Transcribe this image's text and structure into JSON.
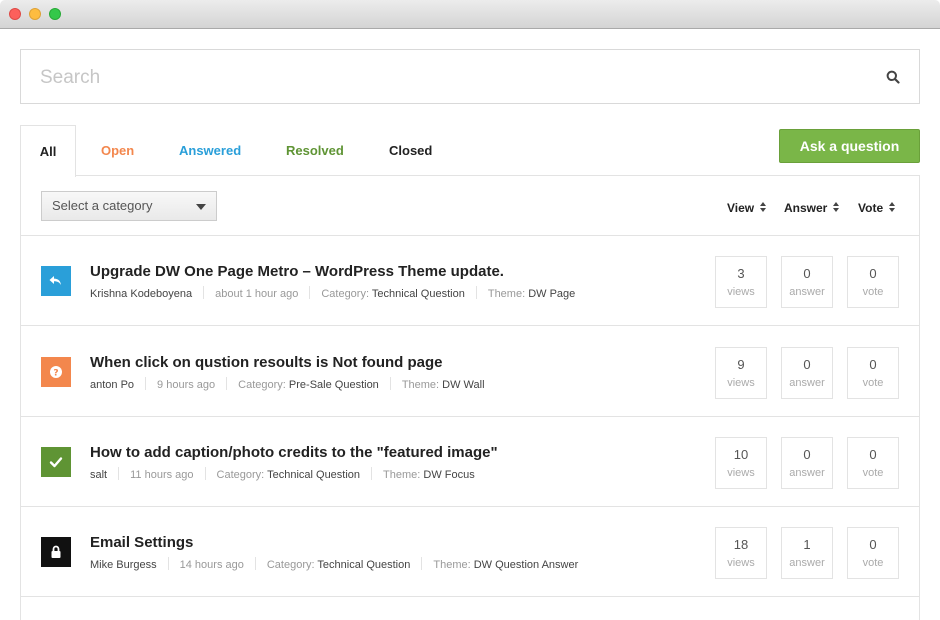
{
  "window": {
    "controls": [
      "close",
      "minimize",
      "zoom"
    ]
  },
  "search": {
    "placeholder": "Search",
    "icon": "search-icon"
  },
  "tabs": [
    {
      "label": "All",
      "color": "#222222",
      "active": true
    },
    {
      "label": "Open",
      "color": "#f3874d"
    },
    {
      "label": "Answered",
      "color": "#2a9fd9"
    },
    {
      "label": "Resolved",
      "color": "#5f9434"
    },
    {
      "label": "Closed",
      "color": "#222222"
    }
  ],
  "ask_button": {
    "label": "Ask a question",
    "color": "#7ab648"
  },
  "filter": {
    "category_placeholder": "Select a category"
  },
  "sort": {
    "view": "View",
    "answer": "Answer",
    "vote": "Vote"
  },
  "questions": [
    {
      "status": "answered",
      "status_icon": "reply-icon",
      "status_color": "#2a9fd9",
      "title": "Upgrade DW One Page Metro – WordPress Theme update.",
      "author": "Krishna Kodeboyena",
      "time": "about 1 hour ago",
      "category_label": "Category:",
      "category": "Technical Question",
      "theme_label": "Theme:",
      "theme": "DW Page",
      "views": "3",
      "views_label": "views",
      "answers": "0",
      "answers_label": "answer",
      "votes": "0",
      "votes_label": "vote"
    },
    {
      "status": "open",
      "status_icon": "question-icon",
      "status_color": "#f3874d",
      "title": "When click on qustion resoults is Not found page",
      "author": "anton Po",
      "time": "9 hours ago",
      "category_label": "Category:",
      "category": "Pre-Sale Question",
      "theme_label": "Theme:",
      "theme": "DW Wall",
      "views": "9",
      "views_label": "views",
      "answers": "0",
      "answers_label": "answer",
      "votes": "0",
      "votes_label": "vote"
    },
    {
      "status": "resolved",
      "status_icon": "checkmark-icon",
      "status_color": "#5f9434",
      "title": "How to add caption/photo credits to the \"featured image\"",
      "author": "salt",
      "time": "11 hours ago",
      "category_label": "Category:",
      "category": "Technical Question",
      "theme_label": "Theme:",
      "theme": "DW Focus",
      "views": "10",
      "views_label": "views",
      "answers": "0",
      "answers_label": "answer",
      "votes": "0",
      "votes_label": "vote"
    },
    {
      "status": "closed",
      "status_icon": "lock-icon",
      "status_color": "#111111",
      "title": "Email Settings",
      "author": "Mike Burgess",
      "time": "14 hours ago",
      "category_label": "Category:",
      "category": "Technical Question",
      "theme_label": "Theme:",
      "theme": "DW Question Answer",
      "views": "18",
      "views_label": "views",
      "answers": "1",
      "answers_label": "answer",
      "votes": "0",
      "votes_label": "vote"
    }
  ]
}
